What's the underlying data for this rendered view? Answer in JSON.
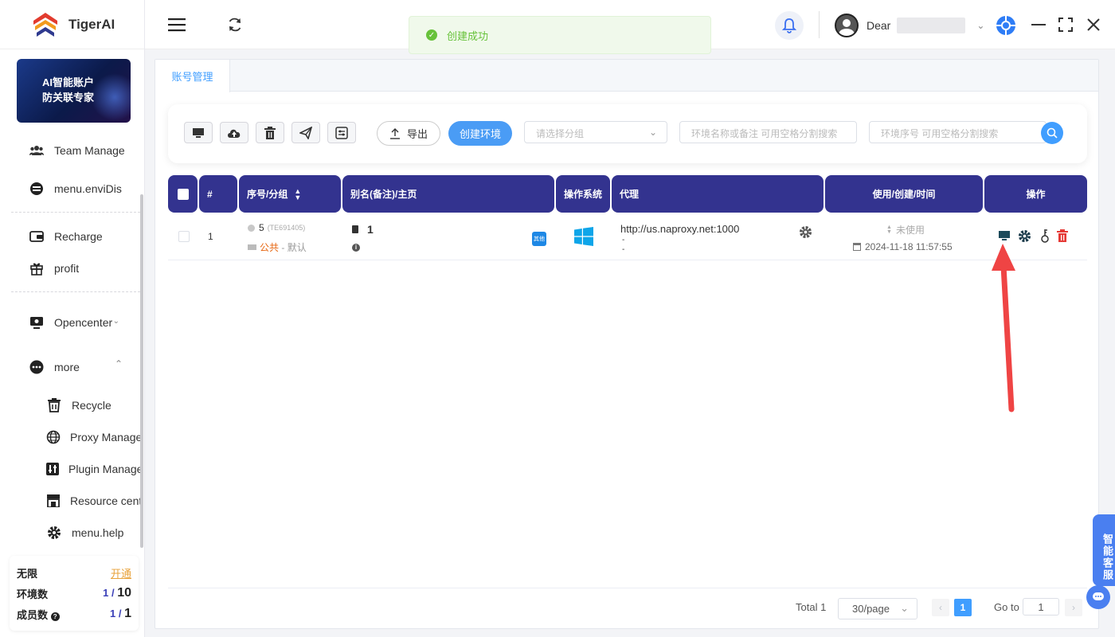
{
  "app": {
    "name": "TigerAI"
  },
  "banner": {
    "line1": "AI智能账户",
    "line2": "防关联专家"
  },
  "sidebar": {
    "items": [
      {
        "label": "Team Manage",
        "icon": "team-icon"
      },
      {
        "label": "menu.enviDis",
        "icon": "environment-icon"
      },
      {
        "label": "Recharge",
        "icon": "wallet-icon"
      },
      {
        "label": "profit",
        "icon": "gift-icon"
      },
      {
        "label": "Opencenter",
        "icon": "monitor-icon"
      },
      {
        "label": "more",
        "icon": "more-icon"
      }
    ],
    "sub_items": [
      {
        "label": "Recycle",
        "icon": "trash-icon"
      },
      {
        "label": "Proxy Manage",
        "icon": "globe-icon"
      },
      {
        "label": "Plugin Manage",
        "icon": "plugin-icon"
      },
      {
        "label": "Resource center",
        "icon": "store-icon"
      },
      {
        "label": "menu.help",
        "icon": "gear-icon"
      }
    ]
  },
  "quota": {
    "plan_label": "无限",
    "plan_link": "开通",
    "env_label": "环境数",
    "env_used": "1 /",
    "env_total": "10",
    "member_label": "成员数",
    "member_used": "1 /",
    "member_total": "1"
  },
  "header": {
    "toast": "创建成功",
    "greeting": "Dear"
  },
  "tabs": [
    {
      "label": "账号管理"
    }
  ],
  "toolbar": {
    "export_label": "导出",
    "create_label": "创建环境",
    "group_placeholder": "请选择分组",
    "name_placeholder": "环境名称或备注 可用空格分割搜索",
    "seq_placeholder": "环境序号 可用空格分割搜索"
  },
  "table": {
    "headers": [
      "#",
      "序号/分组",
      "别名(备注)/主页",
      "操作系统",
      "代理",
      "使用/创建/时间",
      "操作"
    ],
    "rows": [
      {
        "index": "1",
        "seq": "5",
        "code": "(TE691405)",
        "group_public": "公共",
        "group_sep": " - ",
        "group_name": "默认",
        "alias": "1",
        "platform_badge": "其他",
        "os": "windows",
        "proxy": "http://us.naproxy.net:1000",
        "proxy_line2": "-",
        "proxy_line3": "-",
        "usage": "未使用",
        "created": "2024-11-18 11:57:55"
      }
    ]
  },
  "pagination": {
    "total_label": "Total 1",
    "page_size": "30/page",
    "current_page": "1",
    "goto_label": "Go to",
    "goto_value": "1"
  },
  "support": {
    "label": "智能客服"
  },
  "colors": {
    "header_bg": "#33338f",
    "primary": "#409eff",
    "success": "#67c23a",
    "danger": "#e53935",
    "annotation": "#ef4444"
  }
}
